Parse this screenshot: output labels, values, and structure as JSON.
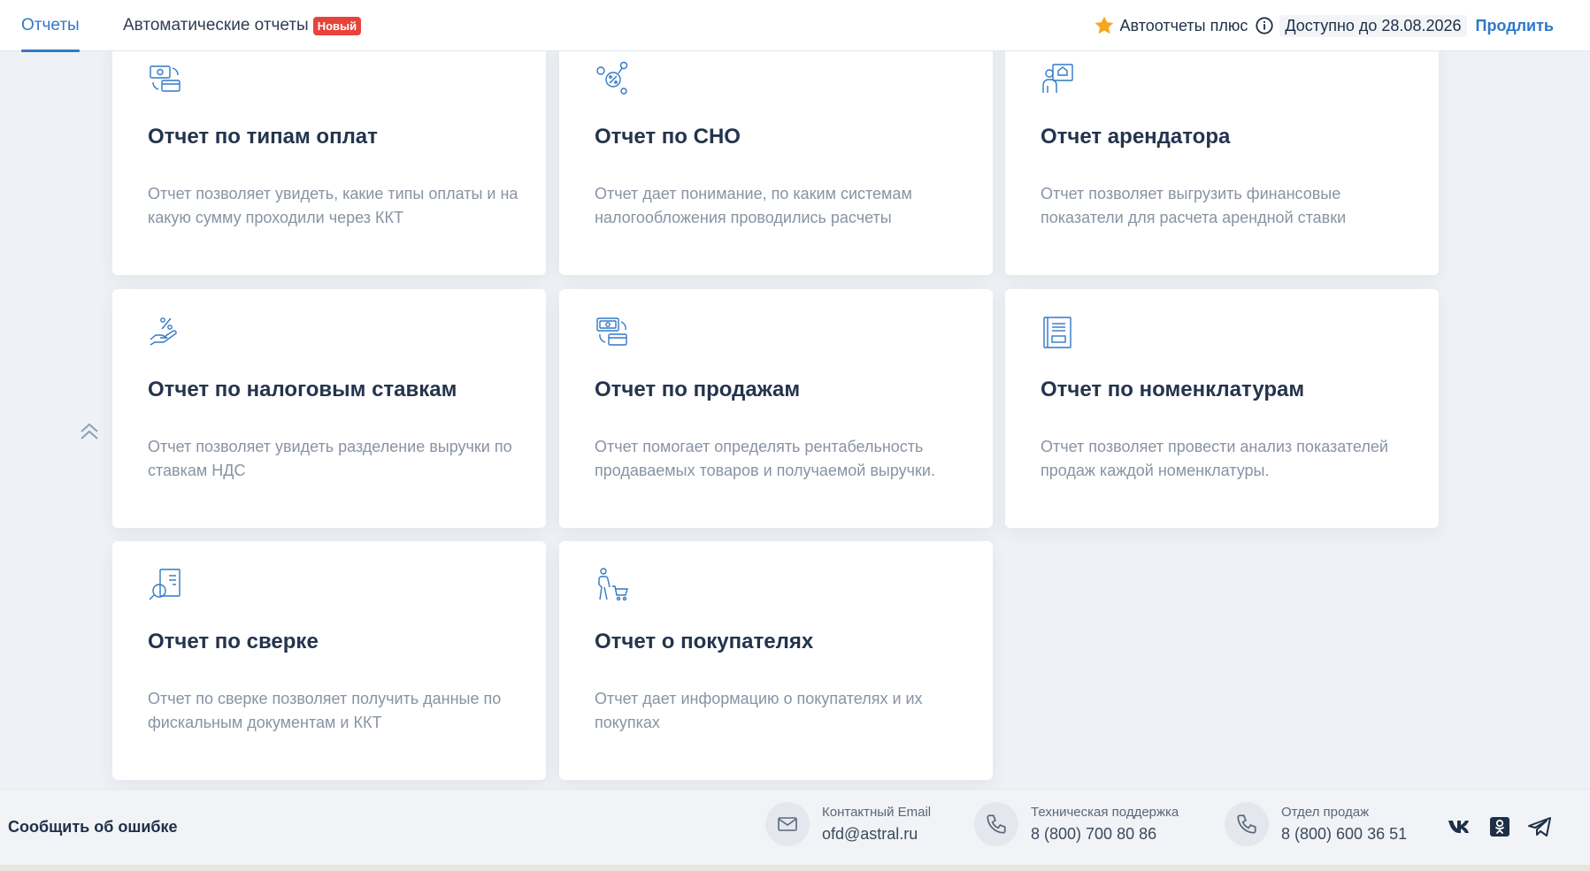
{
  "tabs": [
    {
      "label": "Отчеты",
      "active": true
    },
    {
      "label": "Автоматические отчеты",
      "badge": "Новый",
      "active": false
    }
  ],
  "subscription": {
    "label": "Автоотчеты плюс",
    "until": "Доступно до 28.08.2026",
    "extend": "Продлить"
  },
  "cards": [
    {
      "icon": "cash-card-icon",
      "title": "Отчет по типам оплат",
      "desc": "Отчет позволяет увидеть, какие типы оплаты и на какую сумму проходили через ККТ"
    },
    {
      "icon": "percent-coins-icon",
      "title": "Отчет по СНО",
      "desc": "Отчет дает понимание, по каким системам налогообложения проводились расчеты"
    },
    {
      "icon": "tenant-icon",
      "title": "Отчет арендатора",
      "desc": "Отчет позволяет выгрузить финансовые показатели для расчета арендной ставки"
    },
    {
      "icon": "hand-percent-icon",
      "title": "Отчет по налоговым ставкам",
      "desc": "Отчет позволяет увидеть разделение выручки по ставкам НДС"
    },
    {
      "icon": "cash-exchange-icon",
      "title": "Отчет по продажам",
      "desc": "Отчет помогает определять рентабельность продаваемых товаров и получаемой выручки."
    },
    {
      "icon": "catalog-icon",
      "title": "Отчет по номенклатурам",
      "desc": "Отчет позволяет провести анализ показателей продаж каждой номенклатуры."
    },
    {
      "icon": "document-search-icon",
      "title": "Отчет по сверке",
      "desc": "Отчет по сверке позволяет получить данные по фискальным документам и ККТ"
    },
    {
      "icon": "shopper-cart-icon",
      "title": "Отчет о покупателях",
      "desc": "Отчет дает информацию о покупателях и их покупках"
    }
  ],
  "footer": {
    "report_error": "Сообщить об ошибке",
    "email": {
      "label": "Контактный Email",
      "value": "ofd@astral.ru"
    },
    "support": {
      "label": "Техническая поддержка",
      "value": "8 (800) 700 80 86"
    },
    "sales": {
      "label": "Отдел продаж",
      "value": "8 (800) 600 36 51"
    }
  },
  "colors": {
    "accent": "#3378c7",
    "badge": "#e8433a",
    "star": "#f5a623",
    "icon": "#2f78c8"
  }
}
